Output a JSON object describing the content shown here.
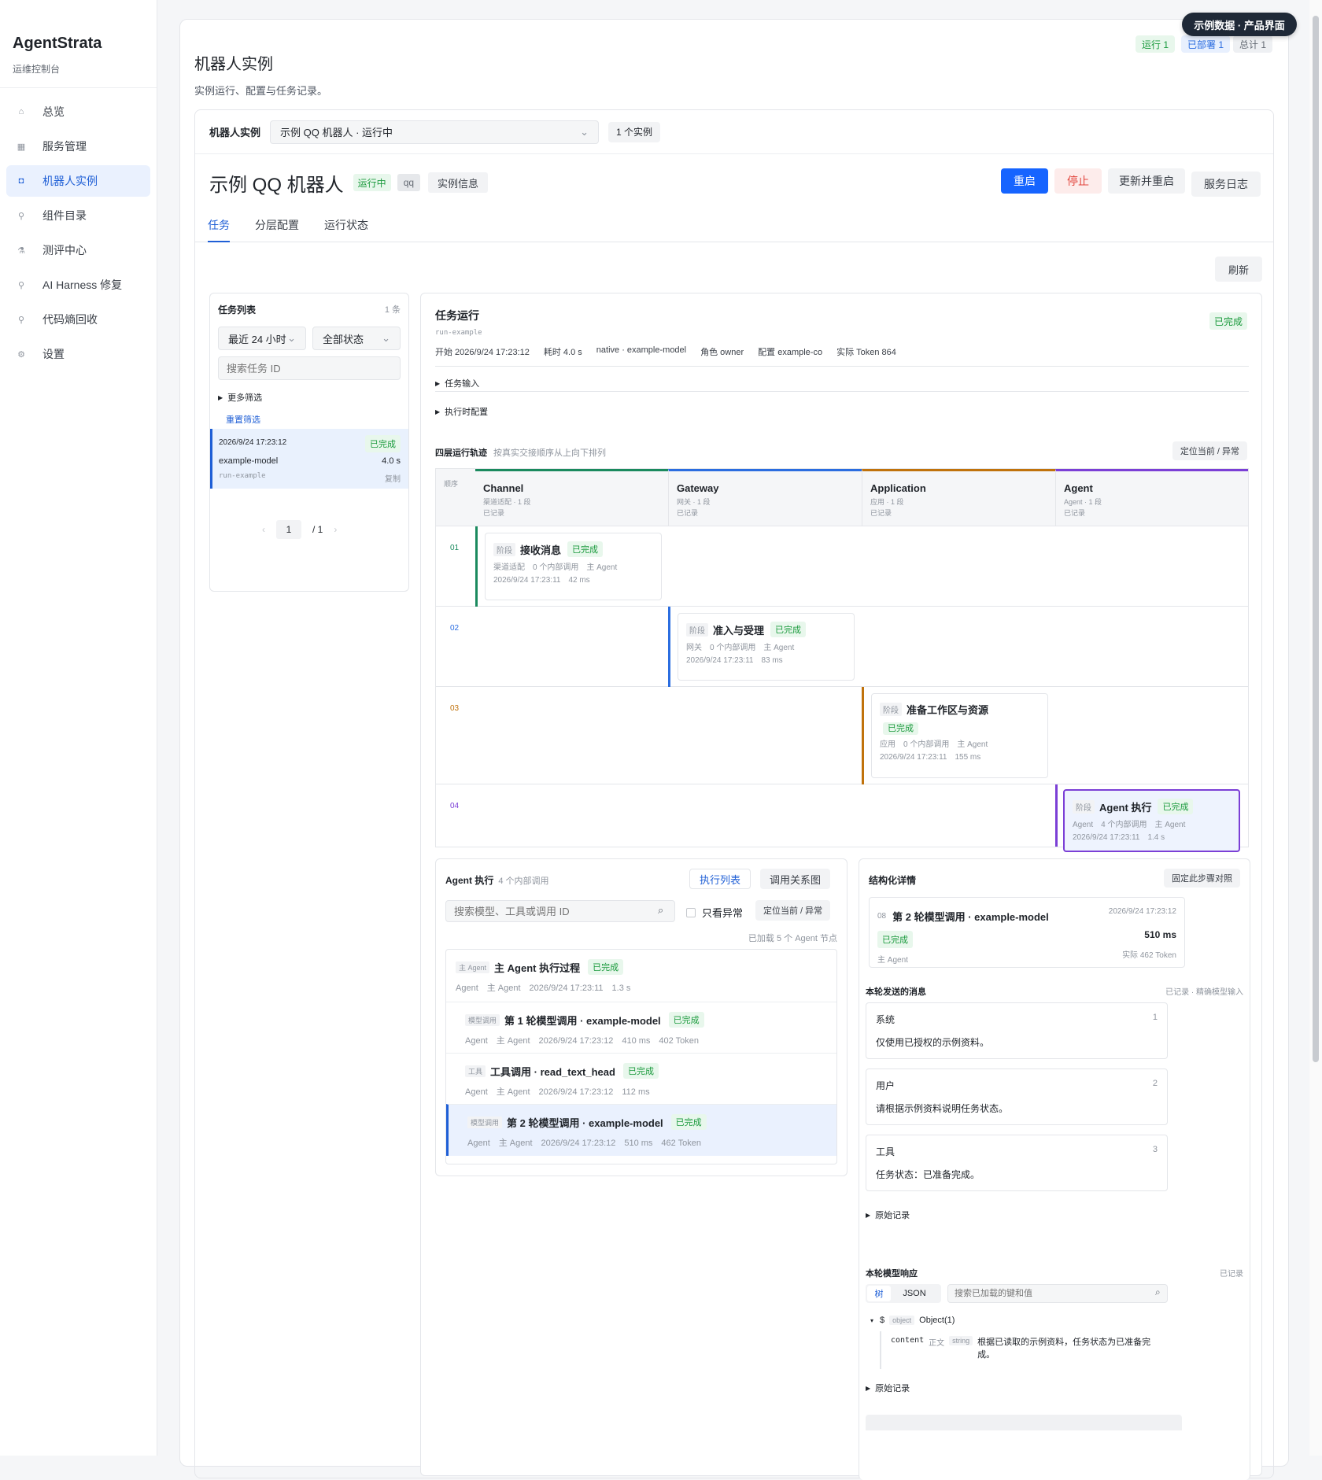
{
  "app": {
    "name": "AgentStrata",
    "subtitle": "运维控制台",
    "demo_chip": "示例数据 · 产品界面"
  },
  "sidebar": {
    "items": [
      {
        "label": "总览",
        "icon": "home-icon"
      },
      {
        "label": "服务管理",
        "icon": "grid-icon"
      },
      {
        "label": "机器人实例",
        "icon": "robot-icon",
        "active": true
      },
      {
        "label": "组件目录",
        "icon": "wrench-icon"
      },
      {
        "label": "测评中心",
        "icon": "flask-icon"
      },
      {
        "label": "AI Harness 修复",
        "icon": "wrench-icon"
      },
      {
        "label": "代码熵回收",
        "icon": "wrench-icon"
      },
      {
        "label": "设置",
        "icon": "gear-icon"
      }
    ]
  },
  "page": {
    "title": "机器人实例",
    "subtitle": "实例运行、配置与任务记录。",
    "badges": {
      "running": "运行 1",
      "deployed": "已部署 1",
      "total": "总计 1"
    }
  },
  "instance": {
    "select_label": "机器人实例",
    "select_value": "示例 QQ 机器人 · 运行中",
    "count": "1 个实例",
    "name": "示例 QQ 机器人",
    "status": "运行中",
    "platform": "qq",
    "info_button": "实例信息",
    "buttons": {
      "restart": "重启",
      "stop": "停止",
      "update": "更新并重启",
      "logs": "服务日志"
    },
    "tabs": [
      "任务",
      "分层配置",
      "运行状态"
    ],
    "refresh": "刷新"
  },
  "task_list": {
    "title": "任务列表",
    "count": "1 条",
    "time_filter": "最近 24 小时",
    "status_filter": "全部状态",
    "search_placeholder": "搜索任务 ID",
    "more_filters": "更多筛选",
    "reset": "重置筛选",
    "items": [
      {
        "time": "2026/9/24 17:23:12",
        "status": "已完成",
        "model": "example-model",
        "duration": "4.0 s",
        "id": "run-example",
        "copy": "复制"
      }
    ],
    "pagination": {
      "page": "1",
      "total": "/ 1"
    }
  },
  "run": {
    "title": "任务运行",
    "id": "run-example",
    "status": "已完成",
    "meta": [
      "开始 2026/9/24 17:23:12",
      "耗时 4.0 s",
      "native · example-model",
      "角色 owner",
      "配置 example-co",
      "实际 Token 864"
    ],
    "sections": [
      "任务输入",
      "执行时配置"
    ],
    "trace_title": "四层运行轨迹",
    "trace_hint": "按真实交接顺序从上向下排列",
    "locate": "定位当前 / 异常",
    "order_label": "顺序",
    "lanes": [
      {
        "name": "Channel",
        "meta1": "渠道适配 · 1 段",
        "meta2": "已记录",
        "color": "#1a8a5e"
      },
      {
        "name": "Gateway",
        "meta1": "网关 · 1 段",
        "meta2": "已记录",
        "color": "#2b6de0"
      },
      {
        "name": "Application",
        "meta1": "应用 · 1 段",
        "meta2": "已记录",
        "color": "#c0720c"
      },
      {
        "name": "Agent",
        "meta1": "Agent · 1 段",
        "meta2": "已记录",
        "color": "#7b3fd6"
      }
    ],
    "stages": [
      {
        "order": "01",
        "tag": "阶段",
        "name": "接收消息",
        "status": "已完成",
        "meta1": "渠道适配　0 个内部调用　主 Agent",
        "meta2": "2026/9/24 17:23:11　42 ms"
      },
      {
        "order": "02",
        "tag": "阶段",
        "name": "准入与受理",
        "status": "已完成",
        "meta1": "网关　0 个内部调用　主 Agent",
        "meta2": "2026/9/24 17:23:11　83 ms"
      },
      {
        "order": "03",
        "tag": "阶段",
        "name": "准备工作区与资源",
        "status": "已完成",
        "meta1": "应用　0 个内部调用　主 Agent",
        "meta2": "2026/9/24 17:23:11　155 ms"
      },
      {
        "order": "04",
        "tag": "阶段",
        "name": "Agent 执行",
        "status": "已完成",
        "meta1": "Agent　4 个内部调用　主 Agent",
        "meta2": "2026/9/24 17:23:11　1.4 s"
      }
    ]
  },
  "agent_exec": {
    "title": "Agent 执行",
    "sub": "4 个内部调用",
    "view_list": "执行列表",
    "view_graph": "调用关系图",
    "search_placeholder": "搜索模型、工具或调用 ID",
    "only_errors": "只看异常",
    "locate": "定位当前 / 异常",
    "loaded": "已加载 5 个 Agent 节点",
    "events": [
      {
        "tag": "主 Agent",
        "name": "主 Agent 执行过程",
        "status": "已完成",
        "meta": "Agent　主 Agent　2026/9/24 17:23:11　1.3 s"
      },
      {
        "tag": "模型调用",
        "name": "第 1 轮模型调用 · example-model",
        "status": "已完成",
        "meta": "Agent　主 Agent　2026/9/24 17:23:12　410 ms　402 Token"
      },
      {
        "tag": "工具",
        "name": "工具调用 · read_text_head",
        "status": "已完成",
        "meta": "Agent　主 Agent　2026/9/24 17:23:12　112 ms"
      },
      {
        "tag": "模型调用",
        "name": "第 2 轮模型调用 · example-model",
        "status": "已完成",
        "meta": "Agent　主 Agent　2026/9/24 17:23:12　510 ms　462 Token"
      }
    ]
  },
  "detail": {
    "title": "结构化详情",
    "pin": "固定此步骤对照",
    "step": {
      "no": "08",
      "name": "第 2 轮模型调用 · example-model",
      "time": "2026/9/24 17:23:12",
      "status": "已完成",
      "duration": "510 ms",
      "agent": "主 Agent",
      "tokens": "实际 462 Token"
    },
    "sent_title": "本轮发送的消息",
    "sent_hint": "已记录 · 精确模型输入",
    "messages": [
      {
        "role": "系统",
        "idx": "1",
        "text": "仅使用已授权的示例资料。"
      },
      {
        "role": "用户",
        "idx": "2",
        "text": "请根据示例资料说明任务状态。"
      },
      {
        "role": "工具",
        "idx": "3",
        "text": "任务状态：已准备完成。"
      }
    ],
    "raw": "原始记录",
    "resp_title": "本轮模型响应",
    "resp_hint": "已记录",
    "view_tree": "树",
    "view_json": "JSON",
    "search_placeholder": "搜索已加载的键和值",
    "tree": {
      "root": "$",
      "root_type": "object",
      "root_value": "Object(1)",
      "key": "content",
      "key_label": "正文",
      "key_type": "string",
      "value": "根据已读取的示例资料，任务状态为已准备完成。"
    }
  }
}
